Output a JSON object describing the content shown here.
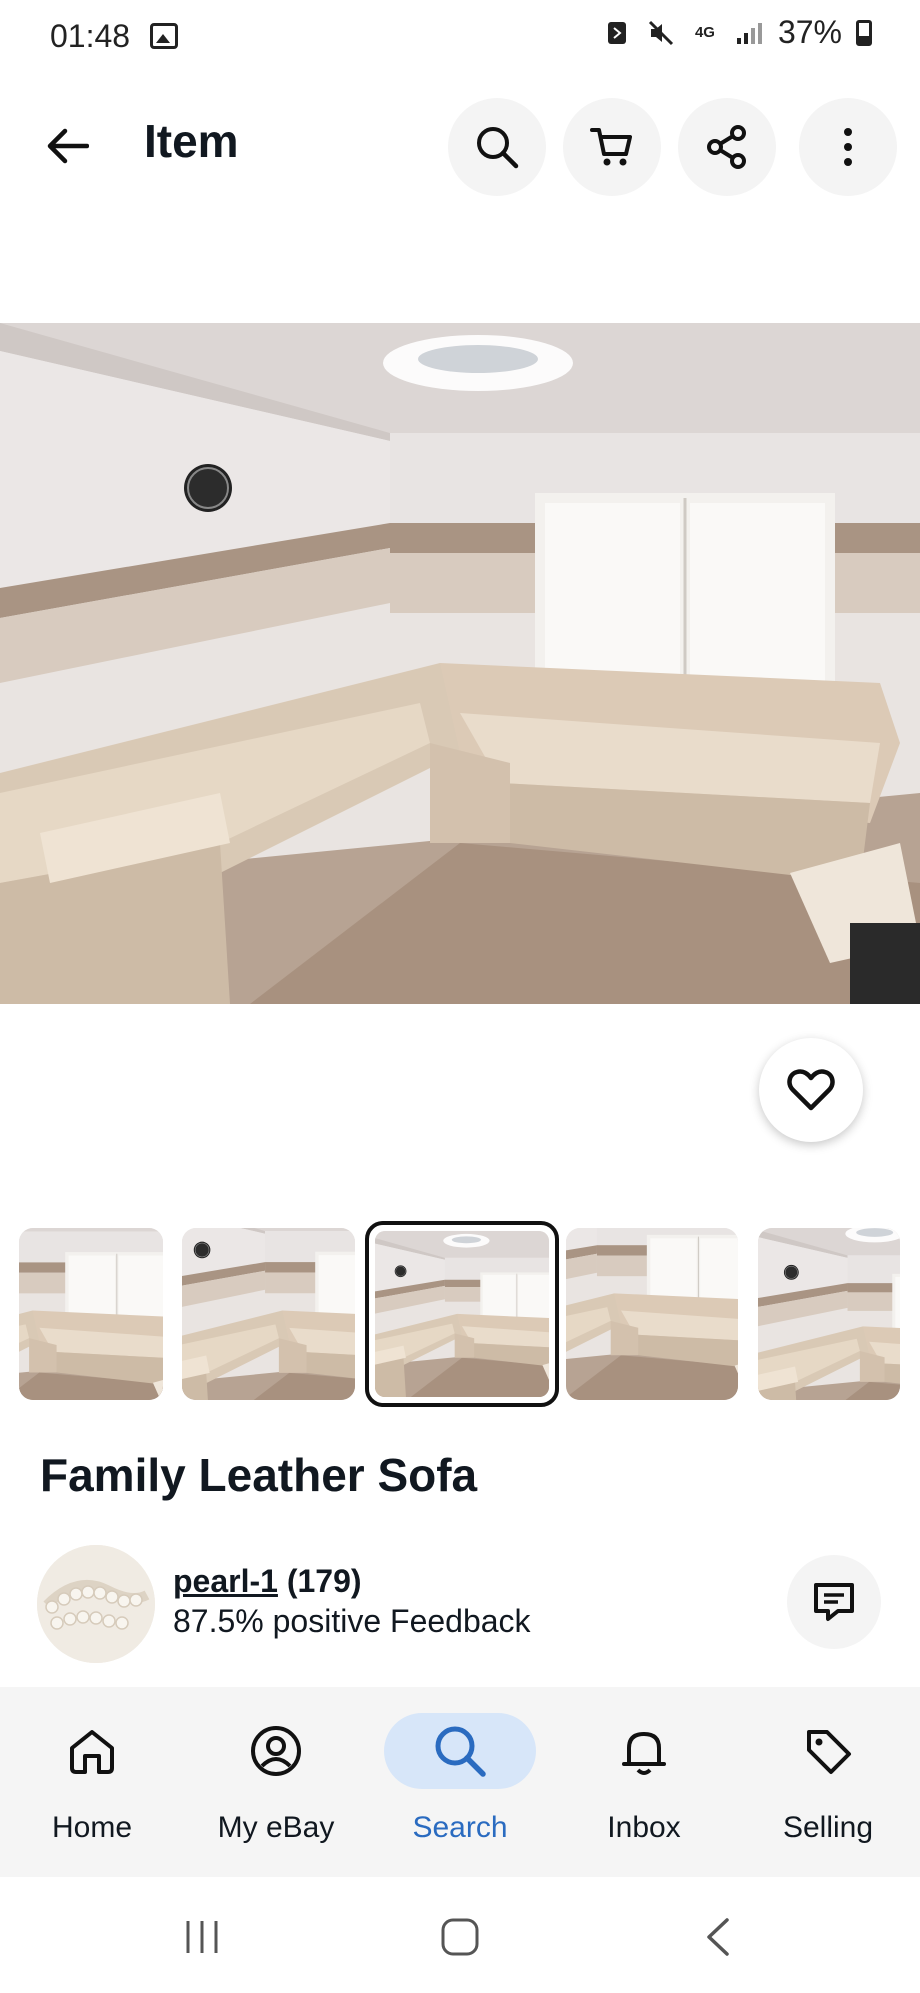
{
  "status_bar": {
    "time": "01:48",
    "network": "4G",
    "battery": "37%"
  },
  "app_bar": {
    "title": "Item"
  },
  "item": {
    "title": "Family Leather Sofa"
  },
  "seller": {
    "name": "pearl-1",
    "count": "(179)",
    "feedback": "87.5% positive Feedback"
  },
  "bottom_nav": {
    "items": [
      {
        "label": "Home",
        "icon": "home-icon"
      },
      {
        "label": "My eBay",
        "icon": "account-icon"
      },
      {
        "label": "Search",
        "icon": "search-icon",
        "active": true
      },
      {
        "label": "Inbox",
        "icon": "bell-icon"
      },
      {
        "label": "Selling",
        "icon": "tag-icon"
      }
    ]
  },
  "colors": {
    "active_nav": "#2a6bc0",
    "active_pill": "#d7e6f9",
    "text": "#111820"
  }
}
